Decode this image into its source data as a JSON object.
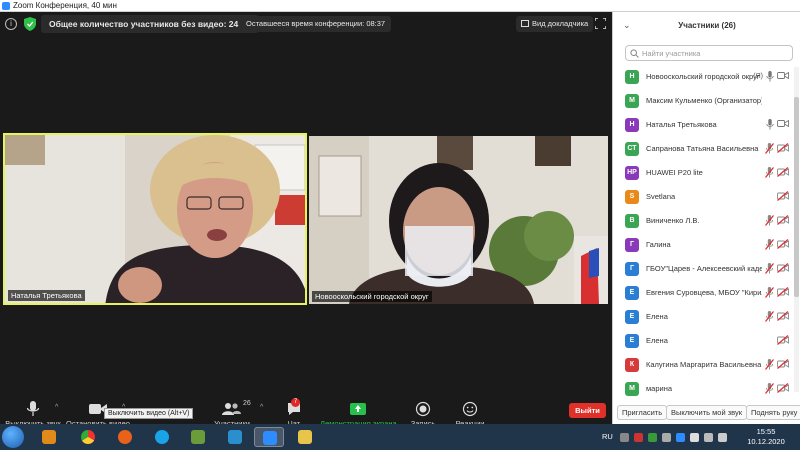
{
  "window": {
    "title": "Zoom Конференция, 40 мин"
  },
  "topbar": {
    "participants_without_video": "Общее количество участников без видео: 24",
    "time_left": "Оставшееся время конференции: 08:37",
    "view_button": "Вид докладчика"
  },
  "videos": [
    {
      "name": "Наталья Третьякова",
      "active_speaker": true
    },
    {
      "name": "Новооскольский городской округ"
    }
  ],
  "toolbar": {
    "mute": "Выключить звук",
    "video": "Остановить видео",
    "video_tooltip": "Выключить видео (Alt+V)",
    "participants": "Участники",
    "participants_count": "26",
    "chat": "Чат",
    "chat_badge": "7",
    "share": "Демонстрация экрана",
    "record": "Запись",
    "reactions": "Реакции",
    "leave": "Выйти"
  },
  "panel": {
    "title": "Участники (26)",
    "search_placeholder": "Найти участника",
    "participants": [
      {
        "initials": "Н",
        "name": "Новооскольский городской округ",
        "suffix": "(Я)",
        "color": "#3aa655",
        "mic": "on",
        "cam": "on"
      },
      {
        "initials": "М",
        "name": "Максим Кульменко (Организатор)",
        "color": "#3aa655",
        "mic": "none",
        "cam": "none"
      },
      {
        "initials": "Н",
        "name": "Наталья Третьякова",
        "color": "#8a3ab8",
        "mic": "on",
        "cam": "on"
      },
      {
        "initials": "СТ",
        "name": "Сапранова Татьяна Васильевна",
        "color": "#3aa655",
        "mic": "off",
        "cam": "off"
      },
      {
        "initials": "HP",
        "name": "HUAWEI P20 lite",
        "color": "#8a3ab8",
        "mic": "off",
        "cam": "off"
      },
      {
        "initials": "S",
        "name": "Svetlana",
        "color": "#e8891a",
        "mic": "none",
        "cam": "off"
      },
      {
        "initials": "В",
        "name": "Виниченко Л.В.",
        "color": "#3aa655",
        "mic": "off",
        "cam": "off"
      },
      {
        "initials": "Г",
        "name": "Галина",
        "color": "#8a3ab8",
        "mic": "off",
        "cam": "off"
      },
      {
        "initials": "Г",
        "name": "ГБОУ\"Царев - Алексеевский кадетский",
        "color": "#2a7fd4",
        "mic": "off",
        "cam": "off"
      },
      {
        "initials": "Е",
        "name": "Евгения Суровцева, МБОУ \"Кирилловская",
        "color": "#2a7fd4",
        "mic": "off",
        "cam": "off"
      },
      {
        "initials": "Е",
        "name": "Елена",
        "color": "#2a7fd4",
        "mic": "off",
        "cam": "off"
      },
      {
        "initials": "Е",
        "name": "Елена",
        "color": "#2a7fd4",
        "mic": "none",
        "cam": "off"
      },
      {
        "initials": "К",
        "name": "Калугина Маргарита Васильевна",
        "color": "#d63a3a",
        "mic": "off",
        "cam": "off"
      },
      {
        "initials": "М",
        "name": "марина",
        "color": "#3aa655",
        "mic": "off",
        "cam": "off"
      }
    ],
    "footer": {
      "invite": "Пригласить",
      "mute_me": "Выключить мой звук",
      "raise_hand": "Поднять руку"
    }
  },
  "taskbar": {
    "lang": "RU",
    "time": "15:55",
    "date": "10.12.2020"
  }
}
